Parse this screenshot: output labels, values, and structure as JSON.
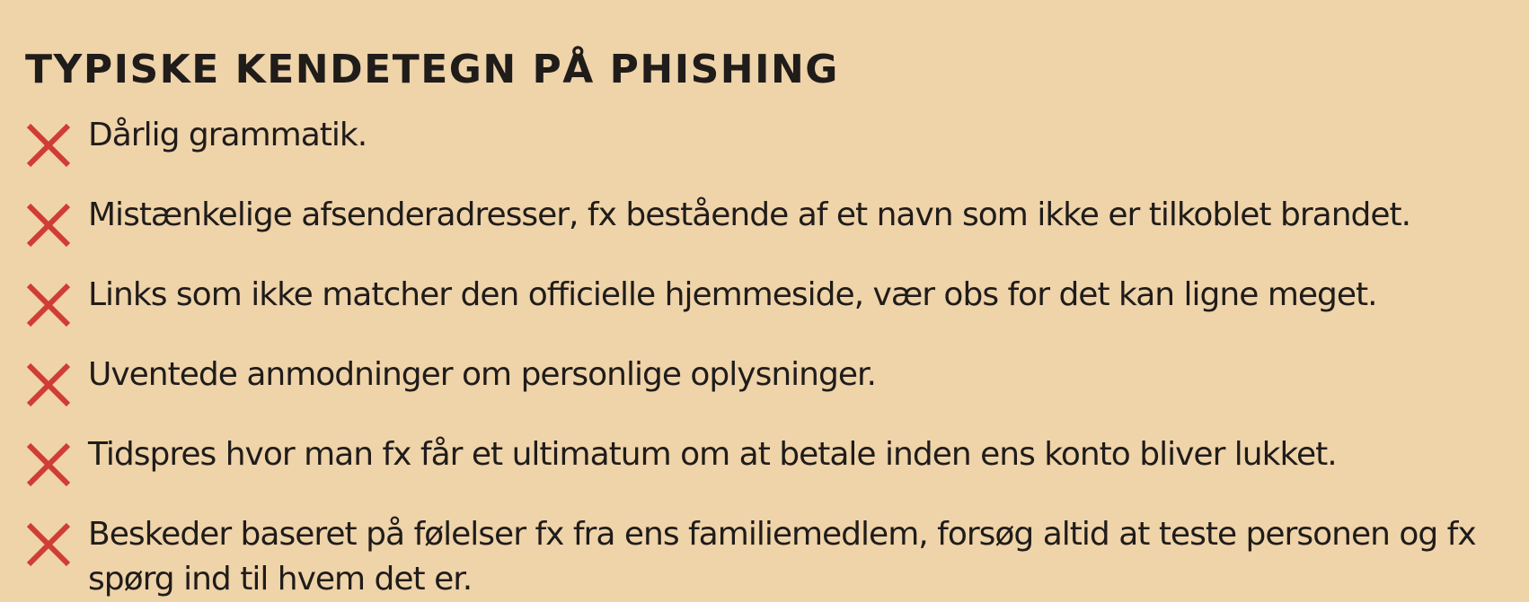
{
  "heading": "TYPISKE KENDETEGN PÅ PHISHING",
  "colors": {
    "background": "#efd3a9",
    "text": "#1f1c1a",
    "x_icon": "#cf3d36"
  },
  "icon_name": "x-mark-icon",
  "items": [
    {
      "text": "Dårlig grammatik."
    },
    {
      "text": "Mistænkelige afsenderadresser, fx bestående af et navn som ikke er tilkoblet brandet."
    },
    {
      "text": "Links som ikke matcher den officielle hjemmeside, vær obs for det kan ligne meget."
    },
    {
      "text": "Uventede anmodninger om personlige oplysninger."
    },
    {
      "text": "Tidspres hvor man fx får et ultimatum om at betale inden ens konto bliver lukket."
    },
    {
      "text": "Beskeder baseret på følelser fx fra ens familiemedlem, forsøg altid at teste personen og fx spørg ind til hvem det er."
    }
  ]
}
